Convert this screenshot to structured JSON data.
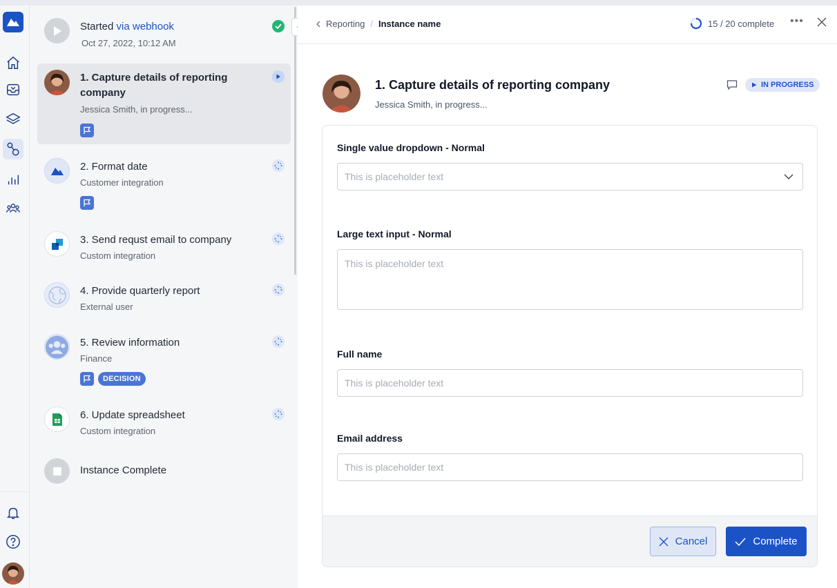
{
  "steps": {
    "started": {
      "prefix": "Started",
      "link": "via webhook",
      "date": "Oct 27, 2022, 10:12 AM"
    },
    "items": [
      {
        "title_line1": "1. Capture details of reporting",
        "title_line2": "company",
        "subtitle": "Jessica Smith, in progress..."
      },
      {
        "title": "2. Format date",
        "subtitle": "Customer integration"
      },
      {
        "title": "3. Send requst email to company",
        "subtitle": "Custom integration"
      },
      {
        "title": "4. Provide quarterly report",
        "subtitle": "External user"
      },
      {
        "title": "5. Review information",
        "subtitle": "Finance",
        "tag": "DECISION"
      },
      {
        "title": "6. Update spreadsheet",
        "subtitle": "Custom integration"
      }
    ],
    "complete": {
      "title": "Instance Complete"
    }
  },
  "topbar": {
    "breadcrumb_parent": "Reporting",
    "breadcrumb_separator": "/",
    "breadcrumb_current": "Instance name",
    "progress_text": "15 / 20 complete",
    "progress_fraction": 0.75
  },
  "task": {
    "title": "1. Capture details of reporting company",
    "subtitle": "Jessica Smith, in progress...",
    "status": "IN PROGRESS"
  },
  "form": {
    "dropdown_label": "Single value dropdown - Normal",
    "dropdown_placeholder": "This is placeholder text",
    "large_label": "Large text input - Normal",
    "large_placeholder": "This is placeholder text",
    "fullname_label": "Full name",
    "fullname_placeholder": "This is placeholder text",
    "email_label": "Email address",
    "email_placeholder": "This is placeholder text",
    "cancel_label": "Cancel",
    "complete_label": "Complete"
  },
  "colors": {
    "accent": "#1b53c6",
    "success": "#22b573",
    "flag": "#4a74d6"
  }
}
